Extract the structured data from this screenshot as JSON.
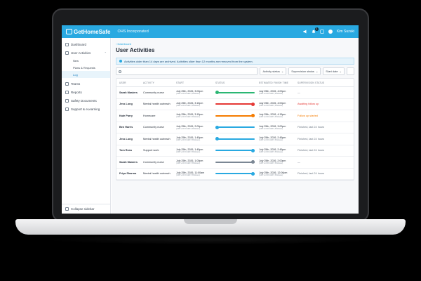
{
  "app": {
    "brand": "GetHomeSafe",
    "org": "OHS Incorporated",
    "user": "Kim Suzuki",
    "notifications": "1"
  },
  "sidebar": {
    "items": [
      {
        "label": "Dashboard"
      },
      {
        "label": "User Activities"
      },
      {
        "label": "Teams"
      },
      {
        "label": "Reports"
      },
      {
        "label": "Safety Documents"
      },
      {
        "label": "Support & eLearning"
      }
    ],
    "subitems": [
      {
        "label": "New"
      },
      {
        "label": "Plans & Requests"
      },
      {
        "label": "Log"
      }
    ],
    "collapse": "Collapse sidebar"
  },
  "main": {
    "breadcrumb": "‹ Dashboard",
    "title": "User Activities",
    "banner": "Activities older than 14 days are archived. Activities older than 12 months are removed from the system.",
    "search_placeholder": "",
    "filters": [
      "Activity status",
      "Supervision status",
      "Start date"
    ]
  },
  "table": {
    "headers": [
      "USER",
      "ACTIVITY",
      "START",
      "STATUS",
      "ESTIMATED FINISH TIME",
      "SUPERVISION STATUS"
    ],
    "tz": "(GMT+10:00 AEST, Brisbane)",
    "rows": [
      {
        "user": "Sarah Masters",
        "activity": "Community nurse",
        "start": "July 25th, 2026, 3:00pm",
        "progress": 0,
        "color": "#2bb673",
        "finish": "July 25th, 2026, 4:00pm",
        "supervision": "—",
        "sv_class": "sv"
      },
      {
        "user": "Jess Long",
        "activity": "Mental health outreach",
        "start": "July 25th, 2026, 3:15pm",
        "progress": 1.0,
        "color": "#e53935",
        "finish": "July 25th, 2026, 4:00pm",
        "supervision": "Awaiting follow up",
        "sv_class": "sv red"
      },
      {
        "user": "Kate Parry",
        "activity": "Homecare",
        "start": "July 25th, 2026, 3:15pm",
        "progress": 1.0,
        "color": "#f57c00",
        "finish": "July 25th, 2026, 4:15pm",
        "supervision": "Follow up started",
        "sv_class": "sv orange"
      },
      {
        "user": "Ben Harris",
        "activity": "Community nurse",
        "start": "July 25th, 2026, 2:00pm",
        "progress": 0,
        "color": "#29a9e1",
        "finish": "July 25th, 2026, 3:00pm",
        "supervision": "Finished, last 24 hours",
        "sv_class": "sv"
      },
      {
        "user": "Jess Long",
        "activity": "Mental health outreach",
        "start": "July 25th, 2026, 1:45pm",
        "progress": 0,
        "color": "#29a9e1",
        "finish": "July 25th, 2026, 2:45pm",
        "supervision": "Finished, last 24 hours",
        "sv_class": "sv"
      },
      {
        "user": "Tom Ross",
        "activity": "Support work",
        "start": "July 25th, 2026, 1:45pm",
        "progress": 1.0,
        "color": "#29a9e1",
        "finish": "July 25th, 2026, 2:45pm",
        "supervision": "Finished, last 24 hours",
        "sv_class": "sv"
      },
      {
        "user": "Sarah Masters",
        "activity": "Community nurse",
        "start": "July 25th, 2026, 1:00pm",
        "progress": 1.0,
        "color": "#7b8794",
        "finish": "July 25th, 2026, 2:00pm",
        "supervision": "—",
        "sv_class": "sv"
      },
      {
        "user": "Priya Sharma",
        "activity": "Mental health outreach",
        "start": "July 25th, 2026, 11:00am",
        "progress": 1.0,
        "color": "#29a9e1",
        "finish": "July 25th, 2026, 12:00pm",
        "supervision": "Finished, last 24 hours",
        "sv_class": "sv"
      }
    ]
  }
}
